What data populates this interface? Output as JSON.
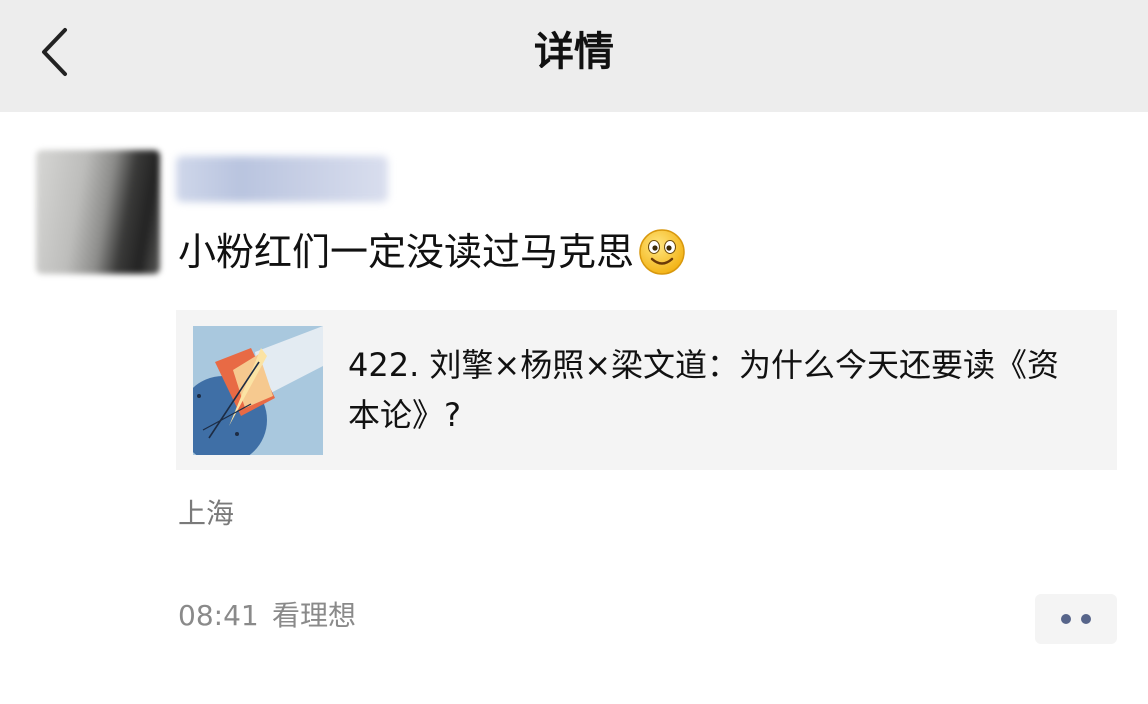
{
  "header": {
    "title": "详情",
    "back_icon": "chevron-left-icon"
  },
  "post": {
    "avatar": "blurred-avatar",
    "username": "blurred-username",
    "text": "小粉红们一定没读过马克思",
    "emoji": "smiling-face-emoji",
    "link_card": {
      "title": "422. 刘擎×杨照×梁文道：为什么今天还要读《资本论》?",
      "thumbnail": "podcast-cover-art"
    },
    "location": "上海",
    "time": "08:41",
    "source": "看理想",
    "more_icon": "more-dots-icon"
  },
  "colors": {
    "topbar": "#ededed",
    "card": "#f4f4f4",
    "meta_text": "#8a8a8a",
    "dots": "#57658a"
  }
}
